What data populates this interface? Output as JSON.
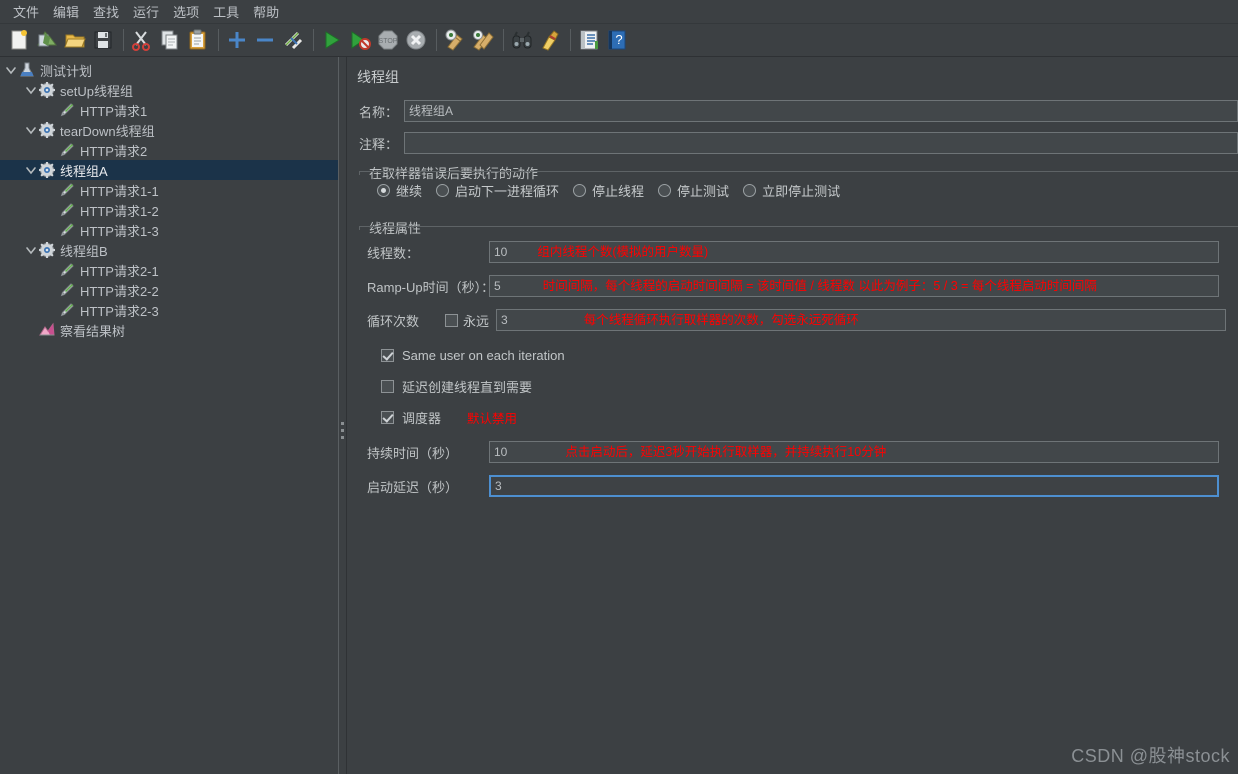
{
  "menubar": {
    "items": [
      {
        "label": "文件",
        "name": "menu-file"
      },
      {
        "label": "编辑",
        "name": "menu-edit"
      },
      {
        "label": "查找",
        "name": "menu-search"
      },
      {
        "label": "运行",
        "name": "menu-run"
      },
      {
        "label": "选项",
        "name": "menu-options"
      },
      {
        "label": "工具",
        "name": "menu-tools"
      },
      {
        "label": "帮助",
        "name": "menu-help"
      }
    ]
  },
  "toolbar": {
    "buttons": [
      {
        "icon": "new-document-icon"
      },
      {
        "icon": "open-templates-icon"
      },
      {
        "icon": "open-folder-icon"
      },
      {
        "icon": "save-icon"
      },
      {
        "sep": true
      },
      {
        "icon": "cut-scissors-icon"
      },
      {
        "icon": "copy-icon"
      },
      {
        "icon": "paste-clipboard-icon"
      },
      {
        "sep": true
      },
      {
        "icon": "expand-plus-icon"
      },
      {
        "icon": "collapse-minus-icon"
      },
      {
        "icon": "toggle-enable-icon"
      },
      {
        "sep": true
      },
      {
        "icon": "start-play-icon"
      },
      {
        "icon": "start-no-timers-icon"
      },
      {
        "icon": "stop-icon"
      },
      {
        "icon": "shutdown-icon"
      },
      {
        "sep": true
      },
      {
        "icon": "clear-icon"
      },
      {
        "icon": "clear-all-icon"
      },
      {
        "sep": true
      },
      {
        "icon": "search-binoculars-icon"
      },
      {
        "icon": "reset-search-broom-icon"
      },
      {
        "sep": true
      },
      {
        "icon": "function-helper-icon"
      },
      {
        "icon": "help-question-icon"
      }
    ]
  },
  "tree": {
    "nodes": [
      {
        "label": "测试计划",
        "depth": 0,
        "icon": "test-plan-icon",
        "toggle": "expanded",
        "selected": false
      },
      {
        "label": "setUp线程组",
        "depth": 1,
        "icon": "thread-group-icon",
        "toggle": "expanded",
        "selected": false
      },
      {
        "label": "HTTP请求1",
        "depth": 2,
        "icon": "http-sampler-icon",
        "toggle": "none",
        "selected": false
      },
      {
        "label": "tearDown线程组",
        "depth": 1,
        "icon": "thread-group-icon",
        "toggle": "expanded",
        "selected": false
      },
      {
        "label": "HTTP请求2",
        "depth": 2,
        "icon": "http-sampler-icon",
        "toggle": "none",
        "selected": false
      },
      {
        "label": "线程组A",
        "depth": 1,
        "icon": "thread-group-icon",
        "toggle": "expanded",
        "selected": true
      },
      {
        "label": "HTTP请求1-1",
        "depth": 2,
        "icon": "http-sampler-icon",
        "toggle": "none",
        "selected": false
      },
      {
        "label": "HTTP请求1-2",
        "depth": 2,
        "icon": "http-sampler-icon",
        "toggle": "none",
        "selected": false
      },
      {
        "label": "HTTP请求1-3",
        "depth": 2,
        "icon": "http-sampler-icon",
        "toggle": "none",
        "selected": false
      },
      {
        "label": "线程组B",
        "depth": 1,
        "icon": "thread-group-icon",
        "toggle": "expanded",
        "selected": false
      },
      {
        "label": "HTTP请求2-1",
        "depth": 2,
        "icon": "http-sampler-icon",
        "toggle": "none",
        "selected": false
      },
      {
        "label": "HTTP请求2-2",
        "depth": 2,
        "icon": "http-sampler-icon",
        "toggle": "none",
        "selected": false
      },
      {
        "label": "HTTP请求2-3",
        "depth": 2,
        "icon": "http-sampler-icon",
        "toggle": "none",
        "selected": false
      },
      {
        "label": "察看结果树",
        "depth": 1,
        "icon": "view-results-tree-icon",
        "toggle": "none",
        "selected": false
      }
    ]
  },
  "config": {
    "panel_title": "线程组",
    "name_label": "名称：",
    "name_value": "线程组A",
    "comment_label": "注释：",
    "comment_value": "",
    "on_error": {
      "group_title": "在取样器错误后要执行的动作",
      "options": [
        {
          "label": "继续",
          "selected": true
        },
        {
          "label": "启动下一进程循环",
          "selected": false
        },
        {
          "label": "停止线程",
          "selected": false
        },
        {
          "label": "停止测试",
          "selected": false
        },
        {
          "label": "立即停止测试",
          "selected": false
        }
      ]
    },
    "thread_props": {
      "group_title": "线程属性",
      "num_threads_label": "线程数：",
      "num_threads_value": "10",
      "num_threads_annotation": "组内线程个数(模拟的用户数量)",
      "ramp_up_label": "Ramp-Up时间（秒）：",
      "ramp_up_value": "5",
      "ramp_up_annotation": "时间间隔，每个线程的启动时间间隔 = 该时间值 / 线程数    以此为例子：5 / 3 = 每个线程启动时间间隔",
      "loop_label": "循环次数",
      "forever_label": "永远",
      "forever_checked": false,
      "loop_value": "3",
      "loop_annotation": "每个线程循环执行取样器的次数，勾选永远死循环",
      "same_user_label": "Same user on each iteration",
      "same_user_checked": true,
      "delay_create_label": "延迟创建线程直到需要",
      "delay_create_checked": false,
      "scheduler_label": "调度器",
      "scheduler_checked": true,
      "scheduler_annotation": "默认禁用",
      "duration_label": "持续时间（秒）",
      "duration_value": "10",
      "duration_annotation": "点击启动后，延迟3秒开始执行取样器，并持续执行10分钟",
      "startup_delay_label": "启动延迟（秒）",
      "startup_delay_value": "3",
      "startup_delay_focused": true
    }
  },
  "watermark": "CSDN @股神stock",
  "colors": {
    "window_bg": "#3c4043",
    "panel_bg": "#3c4043",
    "text": "#c0c4c6",
    "annotation_red": "#ff0000",
    "selection_blue": "#1b3349",
    "focus_border": "#4d8fd0",
    "field_border": "#6e7477"
  }
}
